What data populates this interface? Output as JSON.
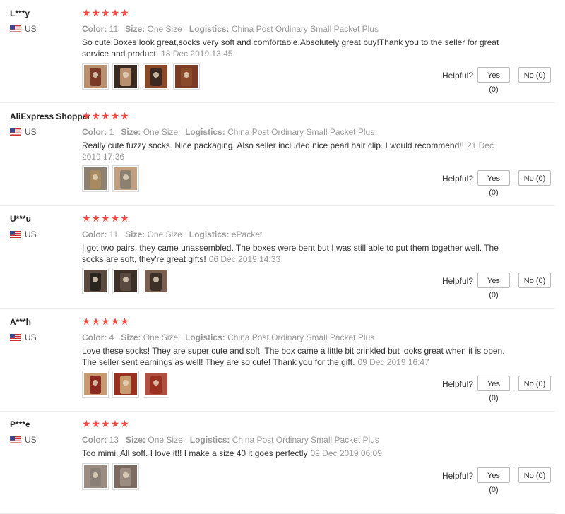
{
  "labels": {
    "color": "Color:",
    "size": "Size:",
    "logistics": "Logistics:",
    "helpful": "Helpful?",
    "yes": "Yes (0)",
    "no": "No (0)"
  },
  "reviews": [
    {
      "user": "L***y",
      "country": "US",
      "rating": 5,
      "color": "11",
      "size": "One Size",
      "logistics": "China Post Ordinary Small Packet Plus",
      "text": "So cute!Boxes look great,socks very soft and comfortable.Absolutely great buy!Thank you to the seller for great service and product!",
      "date": "18 Dec 2019 13:45",
      "photo_count": 4
    },
    {
      "user": "AliExpress Shopper",
      "country": "US",
      "rating": 5,
      "color": "1",
      "size": "One Size",
      "logistics": "China Post Ordinary Small Packet Plus",
      "text": "Really cute fuzzy socks. Nice packaging. Also seller included nice pearl hair clip. I would recommend!!",
      "date": "21 Dec 2019 17:36",
      "photo_count": 2
    },
    {
      "user": "U***u",
      "country": "US",
      "rating": 5,
      "color": "11",
      "size": "One Size",
      "logistics": "ePacket",
      "text": "I got two pairs, they came unassembled. The boxes were bent but I was still able to put them together well. The socks are soft, they're great gifts!",
      "date": "06 Dec 2019 14:33",
      "photo_count": 3
    },
    {
      "user": "A***h",
      "country": "US",
      "rating": 5,
      "color": "4",
      "size": "One Size",
      "logistics": "China Post Ordinary Small Packet Plus",
      "text": "Love these socks! They are super cute and soft. The box came a little bit crinkled but looks great when it is open. The seller sent earnings as well! They are so cute! Thank you for the gift.",
      "date": "09 Dec 2019 16:47",
      "photo_count": 3
    },
    {
      "user": "P***e",
      "country": "US",
      "rating": 5,
      "color": "13",
      "size": "One Size",
      "logistics": "China Post Ordinary Small Packet Plus",
      "text": "Too mimi. All soft. I love it!! I make a size 40 it goes perfectly",
      "date": "09 Dec 2019 06:09",
      "photo_count": 2
    }
  ],
  "icons": {
    "flag": "us-flag-icon",
    "star": "star-icon"
  },
  "colors": {
    "star": "#f04a45",
    "muted": "#999999",
    "text": "#333333"
  }
}
